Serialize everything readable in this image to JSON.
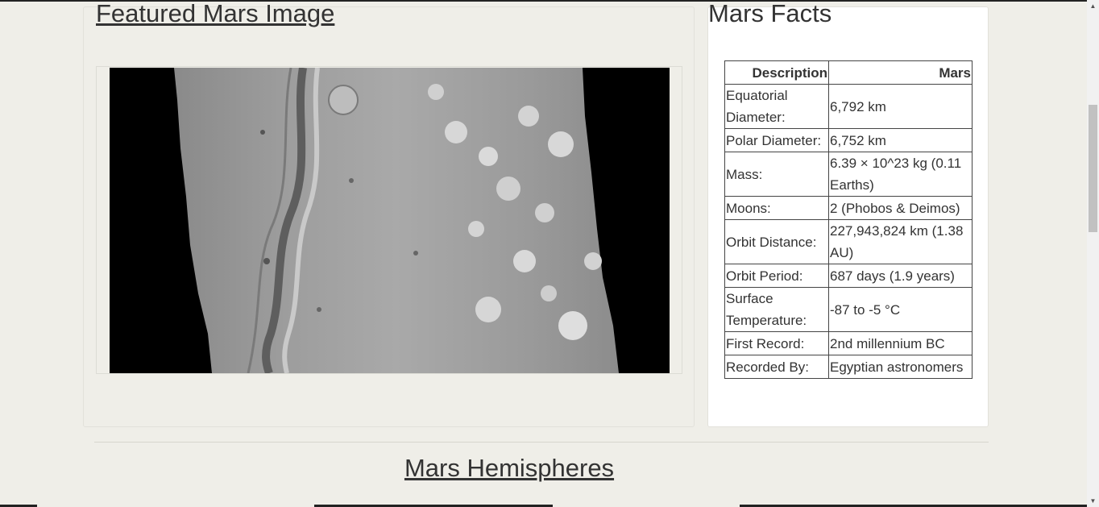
{
  "featured": {
    "heading": "Featured Mars Image"
  },
  "facts": {
    "heading": "Mars Facts",
    "columns": [
      "Description",
      "Mars"
    ],
    "rows": [
      [
        "Equatorial Diameter:",
        "6,792 km"
      ],
      [
        "Polar Diameter:",
        "6,752 km"
      ],
      [
        "Mass:",
        "6.39 × 10^23 kg (0.11 Earths)"
      ],
      [
        "Moons:",
        "2 (Phobos & Deimos)"
      ],
      [
        "Orbit Distance:",
        "227,943,824 km (1.38 AU)"
      ],
      [
        "Orbit Period:",
        "687 days (1.9 years)"
      ],
      [
        "Surface Temperature:",
        "-87 to -5 °C"
      ],
      [
        "First Record:",
        "2nd millennium BC"
      ],
      [
        "Recorded By:",
        "Egyptian astronomers"
      ]
    ]
  },
  "hemispheres": {
    "heading": "Mars Hemispheres"
  },
  "icons": {
    "scroll_up": "scroll-up-arrow-icon",
    "scroll_down": "scroll-down-arrow-icon"
  }
}
